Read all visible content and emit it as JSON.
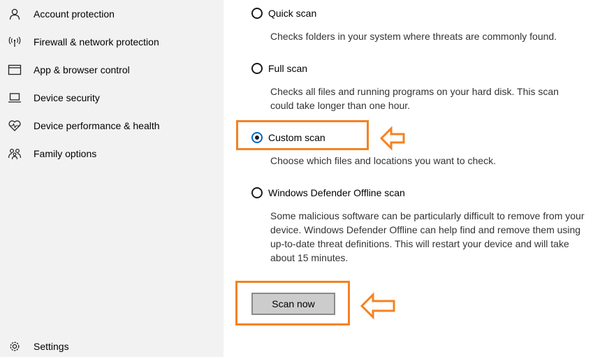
{
  "sidebar": {
    "items": [
      {
        "label": "Account protection",
        "icon": "person-icon"
      },
      {
        "label": "Firewall & network protection",
        "icon": "wireless-icon"
      },
      {
        "label": "App & browser control",
        "icon": "browser-window-icon"
      },
      {
        "label": "Device security",
        "icon": "laptop-icon"
      },
      {
        "label": "Device performance & health",
        "icon": "heart-pulse-icon"
      },
      {
        "label": "Family options",
        "icon": "family-icon"
      }
    ],
    "settings_label": "Settings"
  },
  "scan_options": [
    {
      "label": "Quick scan",
      "description": "Checks folders in your system where threats are commonly found.",
      "selected": false
    },
    {
      "label": "Full scan",
      "description": "Checks all files and running programs on your hard disk. This scan could take longer than one hour.",
      "selected": false
    },
    {
      "label": "Custom scan",
      "description": "Choose which files and locations you want to check.",
      "selected": true
    },
    {
      "label": "Windows Defender Offline scan",
      "description": "Some malicious software can be particularly difficult to remove from your device. Windows Defender Offline can help find and remove them using up-to-date threat definitions. This will restart your device and will take about 15 minutes.",
      "selected": false
    }
  ],
  "scan_button_label": "Scan now",
  "colors": {
    "sidebar_bg": "#f2f2f2",
    "highlight": "#f58220",
    "radio_selected_ring": "#0067c0",
    "button_bg": "#cccccc"
  }
}
